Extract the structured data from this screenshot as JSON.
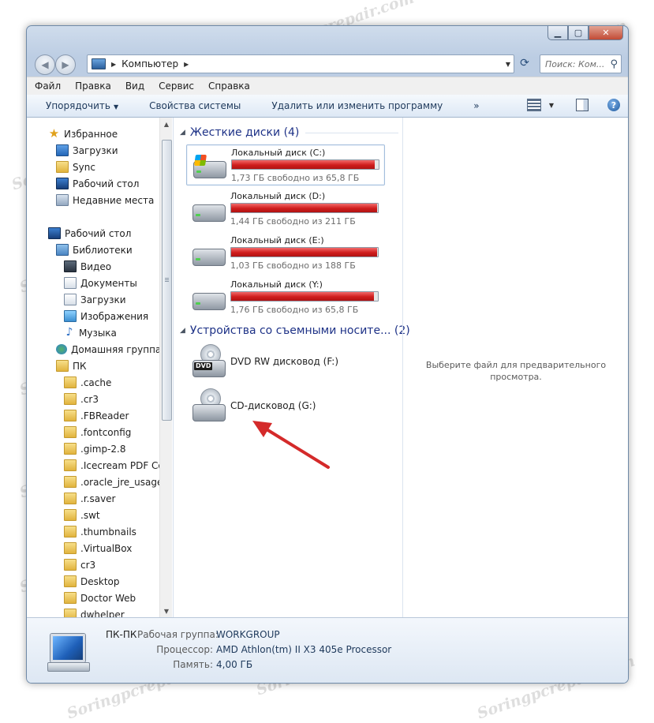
{
  "address": {
    "segment": "Компьютер",
    "search_placeholder": "Поиск: Ком..."
  },
  "menu": [
    "Файл",
    "Правка",
    "Вид",
    "Сервис",
    "Справка"
  ],
  "toolbar": {
    "organize": "Упорядочить",
    "system_props": "Свойства системы",
    "uninstall": "Удалить или изменить программу",
    "more": "»"
  },
  "nav": {
    "favorites": "Избранное",
    "fav_items": [
      "Загрузки",
      "Sync",
      "Рабочий стол",
      "Недавние места"
    ],
    "desktop": "Рабочий стол",
    "libraries": "Библиотеки",
    "lib_items": [
      "Видео",
      "Документы",
      "Загрузки",
      "Изображения",
      "Музыка"
    ],
    "homegroup": "Домашняя группа",
    "pc": "ПК",
    "pc_items": [
      ".cache",
      ".cr3",
      ".FBReader",
      ".fontconfig",
      ".gimp-2.8",
      ".Icecream PDF Con",
      ".oracle_jre_usage",
      ".r.saver",
      ".swt",
      ".thumbnails",
      ".VirtualBox",
      "cr3",
      "Desktop",
      "Doctor Web",
      "dwhelper"
    ]
  },
  "hard_disks": {
    "heading": "Жесткие диски (4)",
    "drives": [
      {
        "name": "Локальный диск (C:)",
        "free": "1,73 ГБ свободно из 65,8 ГБ",
        "used_fraction": 0.974
      },
      {
        "name": "Локальный диск (D:)",
        "free": "1,44 ГБ свободно из 211 ГБ",
        "used_fraction": 0.993
      },
      {
        "name": "Локальный диск (E:)",
        "free": "1,03 ГБ свободно из 188 ГБ",
        "used_fraction": 0.995
      },
      {
        "name": "Локальный диск (Y:)",
        "free": "1,76 ГБ свободно из 65,8 ГБ",
        "used_fraction": 0.973
      }
    ]
  },
  "removable": {
    "heading": "Устройства со съемными носите... (2)",
    "drives": [
      {
        "name": "DVD RW дисковод (F:)",
        "badge": "DVD"
      },
      {
        "name": "CD-дисковод (G:)"
      }
    ]
  },
  "preview_text": "Выберите файл для предварительного просмотра.",
  "details": {
    "computer_name": "ПК-ПК",
    "workgroup_label": "Рабочая группа:",
    "workgroup_value": "WORKGROUP",
    "cpu_label": "Процессор:",
    "cpu_value": "AMD Athlon(tm) II X3 405e Processor",
    "mem_label": "Память:",
    "mem_value": "4,00 ГБ"
  },
  "watermark": "Soringpcrepair.com",
  "colors": {
    "usage_bar": "#cf1d1d",
    "group_heading": "#1e3287",
    "annotation_arrow": "#d42a2a"
  }
}
